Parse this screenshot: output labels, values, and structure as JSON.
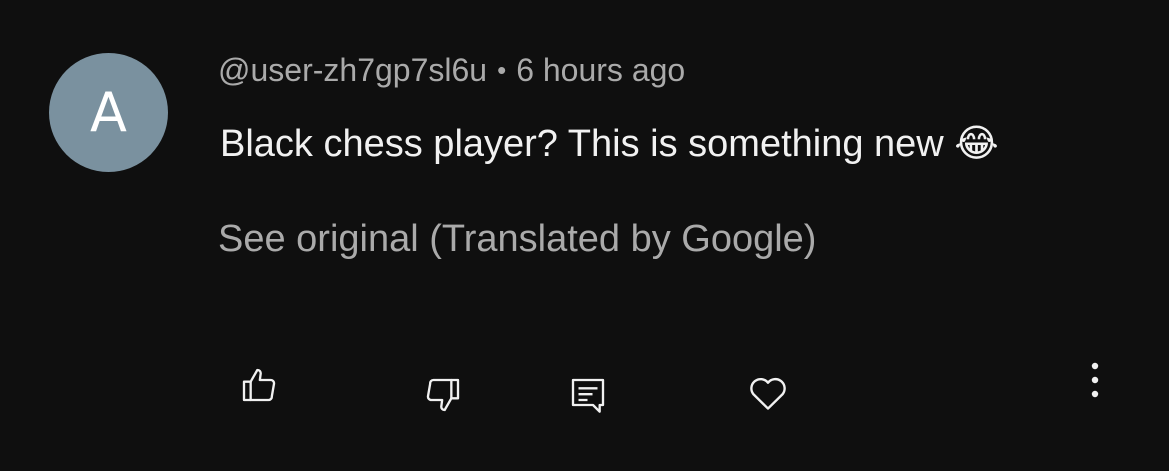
{
  "comment": {
    "avatar_letter": "A",
    "avatar_color": "#7a919f",
    "author": "@user-zh7gp7sl6u",
    "separator": "•",
    "timestamp": "6 hours ago",
    "text": "Black chess player? This is something new 😂",
    "translation_note": "See original (Translated by Google)"
  },
  "actions": {
    "icons": [
      "thumbs-up-icon",
      "thumbs-down-icon",
      "reply-icon",
      "heart-icon",
      "more-vertical-icon"
    ]
  },
  "theme": {
    "background": "#0f0f0f",
    "primary_text": "#f1f1f1",
    "secondary_text": "#aaaaaa"
  }
}
